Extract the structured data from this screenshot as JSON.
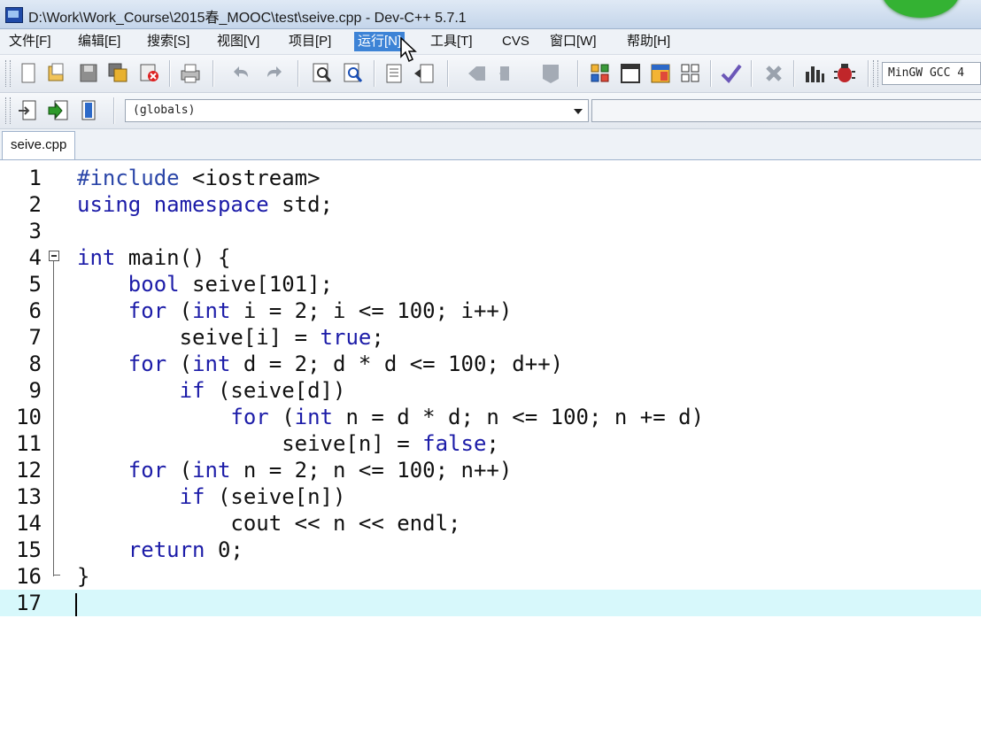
{
  "window": {
    "title": "D:\\Work\\Work_Course\\2015春_MOOC\\test\\seive.cpp - Dev-C++ 5.7.1"
  },
  "menu": [
    {
      "label": "文件[F]"
    },
    {
      "label": "编辑[E]"
    },
    {
      "label": "搜索[S]"
    },
    {
      "label": "视图[V]"
    },
    {
      "label": "项目[P]"
    },
    {
      "label": "运行[N]",
      "active": true
    },
    {
      "label": "工具[T]"
    },
    {
      "label": "CVS"
    },
    {
      "label": "窗口[W]"
    },
    {
      "label": "帮助[H]"
    }
  ],
  "toolbar": {
    "compiler": "MinGW GCC 4",
    "scope": "(globals)"
  },
  "tabs": [
    {
      "label": "seive.cpp",
      "active": true
    }
  ],
  "editor": {
    "current_line": 17,
    "lines": [
      {
        "num": "1",
        "code": "#include <iostream>"
      },
      {
        "num": "2",
        "code": "using namespace std;"
      },
      {
        "num": "3",
        "code": ""
      },
      {
        "num": "4",
        "code": "int main() {"
      },
      {
        "num": "5",
        "code": "    bool seive[101];"
      },
      {
        "num": "6",
        "code": "    for (int i = 2; i <= 100; i++)"
      },
      {
        "num": "7",
        "code": "        seive[i] = true;"
      },
      {
        "num": "8",
        "code": "    for (int d = 2; d * d <= 100; d++)"
      },
      {
        "num": "9",
        "code": "        if (seive[d])"
      },
      {
        "num": "10",
        "code": "            for (int n = d * d; n <= 100; n += d)"
      },
      {
        "num": "11",
        "code": "                seive[n] = false;"
      },
      {
        "num": "12",
        "code": "    for (int n = 2; n <= 100; n++)"
      },
      {
        "num": "13",
        "code": "        if (seive[n])"
      },
      {
        "num": "14",
        "code": "            cout << n << endl;"
      },
      {
        "num": "15",
        "code": "    return 0;"
      },
      {
        "num": "16",
        "code": "}"
      },
      {
        "num": "17",
        "code": ""
      }
    ]
  },
  "colors": {
    "keyword": "#1c1ca8",
    "current_line": "#d7f8fb",
    "menu_active": "#3d83d6"
  }
}
